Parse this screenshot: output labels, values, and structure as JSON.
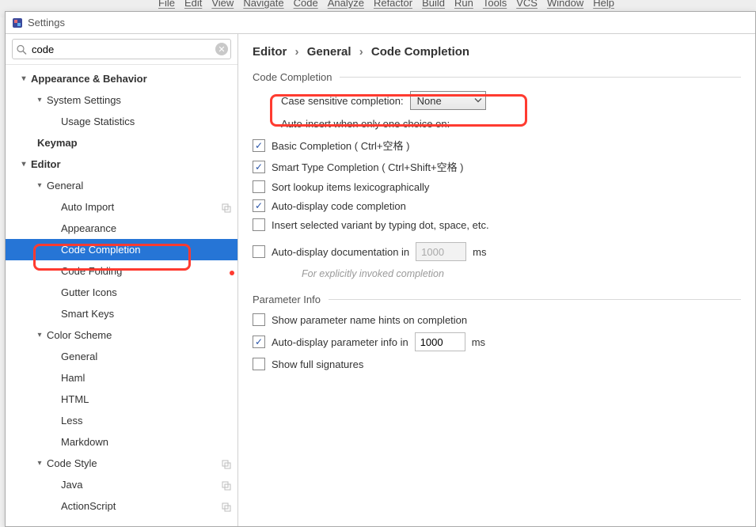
{
  "menubar": [
    "File",
    "Edit",
    "View",
    "Navigate",
    "Code",
    "Analyze",
    "Refactor",
    "Build",
    "Run",
    "Tools",
    "VCS",
    "Window",
    "Help"
  ],
  "dialog_title": "Settings",
  "search": {
    "value": "code"
  },
  "tree": {
    "appearance_behavior": "Appearance & Behavior",
    "system_settings": "System Settings",
    "usage_statistics": "Usage Statistics",
    "keymap": "Keymap",
    "editor": "Editor",
    "general": "General",
    "auto_import": "Auto Import",
    "appearance": "Appearance",
    "code_completion": "Code Completion",
    "code_folding": "Code Folding",
    "gutter_icons": "Gutter Icons",
    "smart_keys": "Smart Keys",
    "color_scheme": "Color Scheme",
    "cs_general": "General",
    "cs_haml": "Haml",
    "cs_html": "HTML",
    "cs_less": "Less",
    "cs_markdown": "Markdown",
    "code_style": "Code Style",
    "cs_java": "Java",
    "cs_actionscript": "ActionScript"
  },
  "breadcrumb": {
    "p1": "Editor",
    "p2": "General",
    "p3": "Code Completion"
  },
  "sections": {
    "code_completion": "Code Completion",
    "parameter_info": "Parameter Info"
  },
  "form": {
    "case_sensitive_label": "Case sensitive completion:",
    "case_sensitive_value": "None",
    "auto_insert_label": "Auto-insert when only one choice on:",
    "basic_completion": "Basic Completion ( Ctrl+空格 )",
    "basic_completion_checked": true,
    "smart_type_completion": "Smart Type Completion ( Ctrl+Shift+空格 )",
    "smart_type_completion_checked": true,
    "sort_lookup": "Sort lookup items lexicographically",
    "sort_lookup_checked": false,
    "auto_display": "Auto-display code completion",
    "auto_display_checked": true,
    "insert_selected": "Insert selected variant by typing dot, space, etc.",
    "insert_selected_checked": false,
    "auto_doc": "Auto-display documentation in",
    "auto_doc_checked": false,
    "auto_doc_value": "1000",
    "ms": "ms",
    "auto_doc_hint": "For explicitly invoked completion",
    "show_param_hints": "Show parameter name hints on completion",
    "show_param_hints_checked": false,
    "auto_param_info": "Auto-display parameter info in",
    "auto_param_info_checked": true,
    "auto_param_info_value": "1000",
    "show_full_sig": "Show full signatures",
    "show_full_sig_checked": false
  }
}
